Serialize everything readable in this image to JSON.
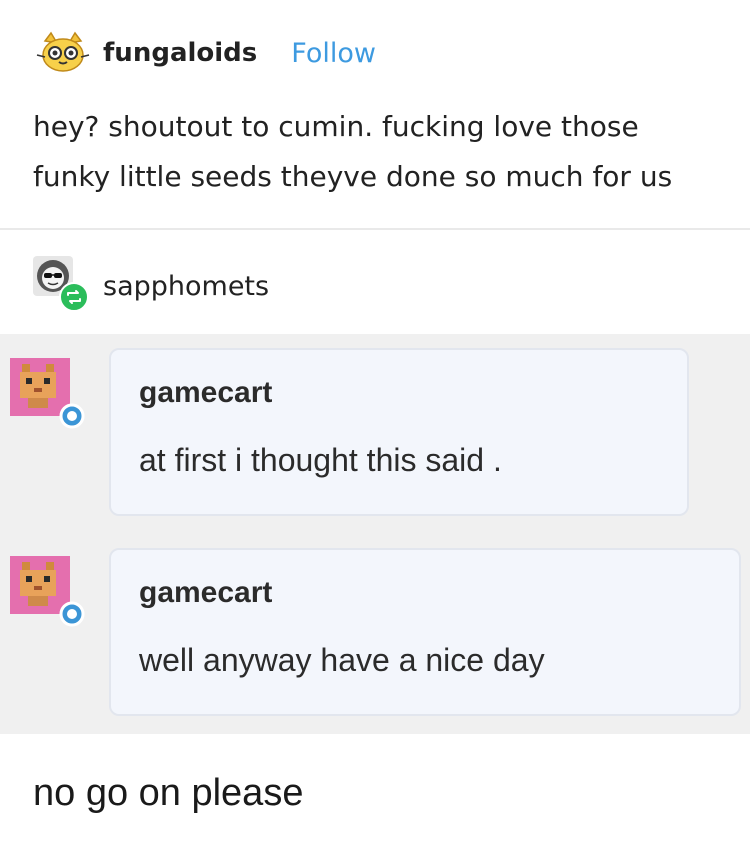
{
  "post": {
    "username": "fungaloids",
    "follow_label": "Follow",
    "text_lines": [
      "hey? shoutout to cumin. fucking love those",
      "funky little seeds theyve done so much for us"
    ],
    "avatar_icon": "cat-face-icon"
  },
  "reblog": {
    "username": "sapphomets",
    "avatar_icon": "sunglasses-face-icon",
    "badge_icon": "reblog-icon",
    "badge_color": "#2bbd5b"
  },
  "comments": [
    {
      "username": "gamecart",
      "text": "at first i thought this said .",
      "avatar_icon": "cat-pixel-icon",
      "status_color": "#3b95d6"
    },
    {
      "username": "gamecart",
      "text": "well anyway have a nice day",
      "avatar_icon": "cat-pixel-icon",
      "status_color": "#3b95d6"
    }
  ],
  "caption": "no go on please",
  "colors": {
    "follow": "#3d9ae0",
    "screenshot_bg": "#f0f0f0",
    "bubble_bg": "#f3f6fc"
  }
}
